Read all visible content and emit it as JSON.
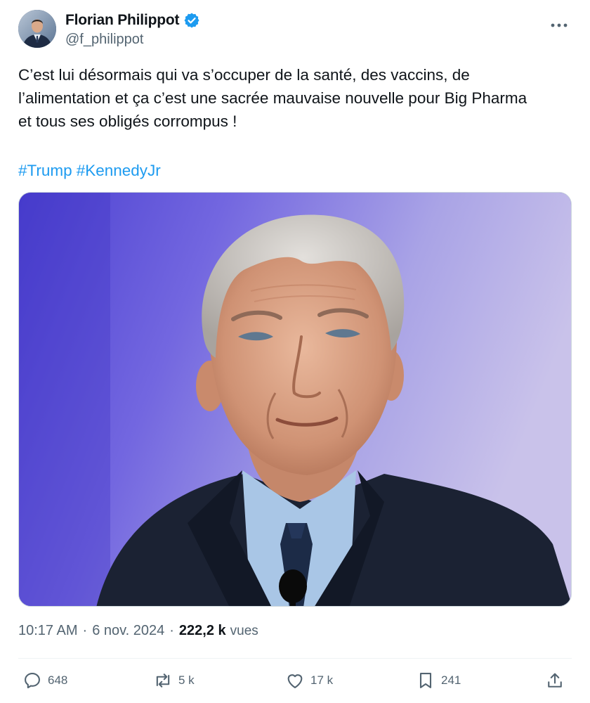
{
  "author": {
    "display_name": "Florian Philippot",
    "handle": "@f_philippot",
    "verified": true,
    "avatar_icon": "profile-photo"
  },
  "more_icon": "more-horizontal-icon",
  "post": {
    "text": "C’est lui désormais qui va s’occuper de la santé, des vaccins, de\nl’alimentation et ça c’est une sacrée mauvaise nouvelle pour Big Pharma\net tous ses obligés corrompus !",
    "hashtags": [
      "#Trump",
      "#KennedyJr"
    ]
  },
  "media": {
    "type": "photo",
    "icon": "portrait-photo"
  },
  "meta": {
    "time": "10:17 AM",
    "separator": "·",
    "date": "6 nov. 2024",
    "views_count": "222,2 k",
    "views_label": "vues"
  },
  "actions": {
    "replies": "648",
    "reposts": "5 k",
    "likes": "17 k",
    "bookmarks": "241"
  },
  "colors": {
    "accent": "#1d9bf0",
    "secondary_text": "#536471",
    "primary_text": "#0f1419",
    "border": "#cfd9de"
  }
}
